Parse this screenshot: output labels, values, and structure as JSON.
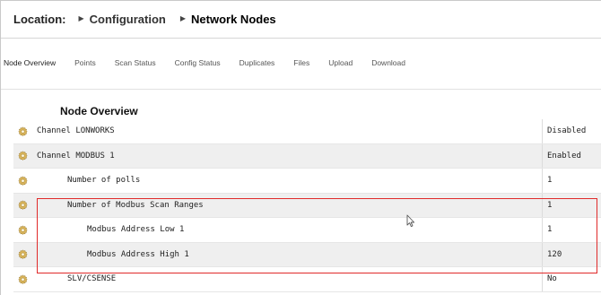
{
  "breadcrumb": {
    "label": "Location:",
    "items": [
      "Configuration",
      "Network Nodes"
    ]
  },
  "tabs": [
    {
      "label": "Node Overview",
      "active": true
    },
    {
      "label": "Points"
    },
    {
      "label": "Scan Status"
    },
    {
      "label": "Config Status"
    },
    {
      "label": "Duplicates"
    },
    {
      "label": "Files"
    },
    {
      "label": "Upload"
    },
    {
      "label": "Download"
    }
  ],
  "section_title": "Node Overview",
  "rows": [
    {
      "label": "Channel LONWORKS",
      "value": "Disabled",
      "level": 0
    },
    {
      "label": "Channel MODBUS 1",
      "value": "Enabled",
      "level": 0
    },
    {
      "label": "Number of polls",
      "value": "1",
      "level": 1
    },
    {
      "label": "Number of Modbus Scan Ranges",
      "value": "1",
      "level": 1
    },
    {
      "label": "Modbus Address Low 1",
      "value": "1",
      "level": 2
    },
    {
      "label": "Modbus Address High 1",
      "value": "120",
      "level": 2
    },
    {
      "label": "SLV/CSENSE",
      "value": "No",
      "level": 1
    }
  ],
  "colors": {
    "highlight": "#e02a2a",
    "gear_icon": "#d9b45a"
  },
  "icons": {
    "row_icon": "gear-icon",
    "breadcrumb_separator": "triangle-right-icon",
    "pointer": "mouse-cursor-icon"
  }
}
